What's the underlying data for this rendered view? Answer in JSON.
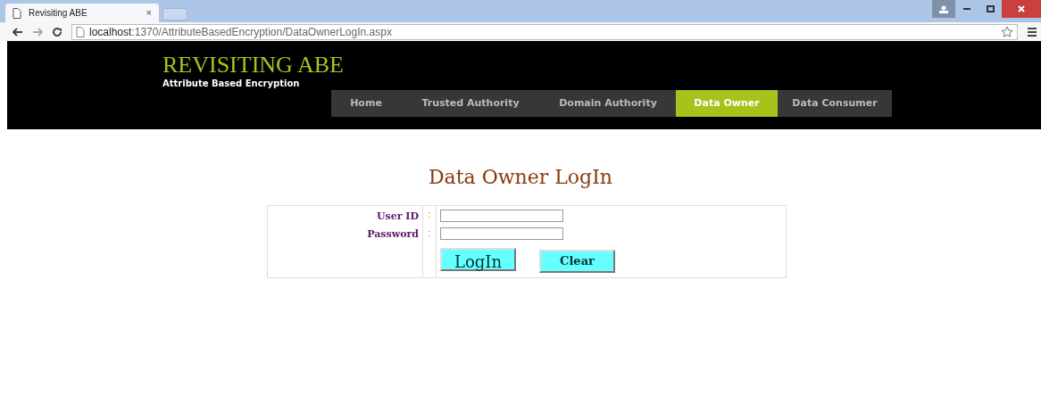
{
  "browser": {
    "tab_title": "Revisiting ABE",
    "tab_close": "×",
    "url_host": "localhost",
    "url_path": ":1370/AttributeBasedEncryption/DataOwnerLogIn.aspx"
  },
  "header": {
    "title": "REVISITING ABE",
    "subtitle": "Attribute Based Encryption"
  },
  "nav": [
    {
      "label": "Home",
      "selected": false
    },
    {
      "label": "Trusted Authority",
      "selected": false
    },
    {
      "label": "Domain Authority",
      "selected": false
    },
    {
      "label": "Data Owner",
      "selected": true
    },
    {
      "label": "Data Consumer",
      "selected": false
    }
  ],
  "heading": "Data Owner LogIn",
  "form": {
    "fields": [
      {
        "label": "User ID",
        "colon": ":"
      },
      {
        "label": "Password",
        "colon": ":"
      }
    ],
    "buttons": [
      {
        "label": "LogIn",
        "kind": "primary"
      },
      {
        "label": "Clear",
        "kind": "secondary"
      }
    ]
  }
}
